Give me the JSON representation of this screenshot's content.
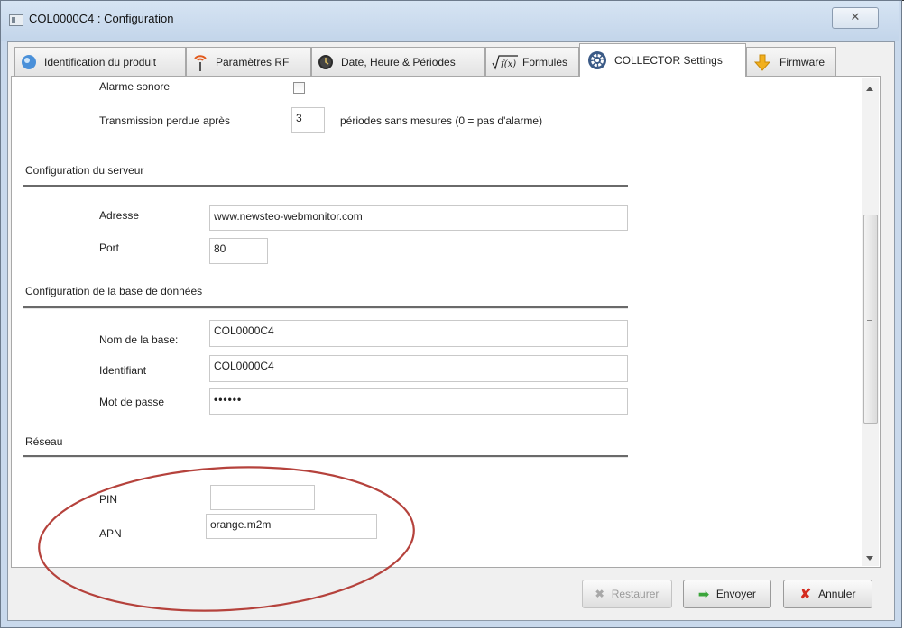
{
  "window": {
    "title": "COL0000C4 : Configuration",
    "close_glyph": "✕"
  },
  "tabs": [
    {
      "label": "Identification du produit",
      "icon": "bubble-icon",
      "active": false
    },
    {
      "label": "Paramètres RF",
      "icon": "antenna-icon",
      "active": false
    },
    {
      "label": "Date, Heure & Périodes",
      "icon": "clock-icon",
      "active": false
    },
    {
      "label": "Formules",
      "icon": "formula-icon",
      "active": false
    },
    {
      "label": "COLLECTOR Settings",
      "icon": "gear-icon",
      "active": true
    },
    {
      "label": "Firmware",
      "icon": "download-arrow-icon",
      "active": false
    }
  ],
  "form": {
    "alarm_sound_label": "Alarme sonore",
    "alarm_sound_checked": false,
    "transmission_lost_label": "Transmission perdue après",
    "transmission_lost_value": "3",
    "transmission_lost_suffix": "périodes sans mesures (0 = pas d'alarme)",
    "server_section": "Configuration du serveur",
    "address_label": "Adresse",
    "address_value": "www.newsteo-webmonitor.com",
    "port_label": "Port",
    "port_value": "80",
    "db_section": "Configuration de la base de données",
    "db_name_label": "Nom de la base:",
    "db_name_value": "COL0000C4",
    "identifier_label": "Identifiant",
    "identifier_value": "COL0000C4",
    "password_label": "Mot de passe",
    "password_value": "••••••",
    "network_section": "Réseau",
    "pin_label": "PIN",
    "pin_value": "",
    "apn_label": "APN",
    "apn_value": "orange.m2m"
  },
  "buttons": {
    "restore": {
      "label": "Restaurer",
      "icon_glyph": "✖",
      "enabled": false
    },
    "send": {
      "label": "Envoyer",
      "icon_glyph": "➡",
      "enabled": true
    },
    "cancel": {
      "label": "Annuler",
      "icon_glyph": "✘",
      "enabled": true
    }
  },
  "colors": {
    "highlight_ellipse": "#b5423c",
    "send_icon": "#3aa53a",
    "cancel_icon": "#d42b1e"
  }
}
